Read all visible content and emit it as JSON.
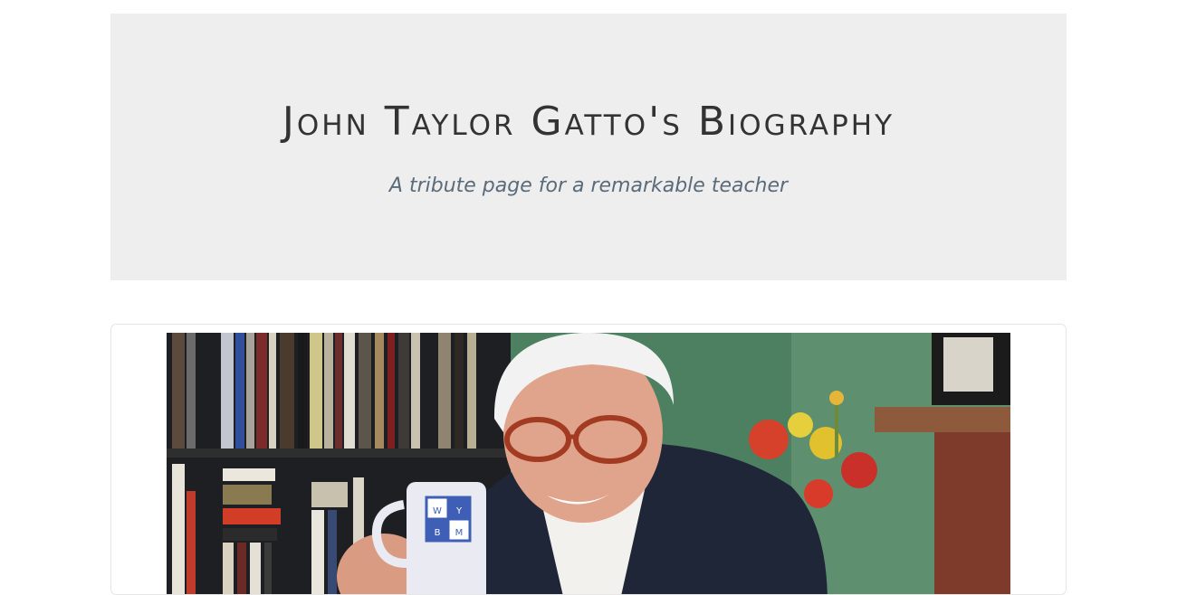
{
  "header": {
    "title": "John Taylor Gatto's Biography",
    "subtitle": "A tribute page for a remarkable teacher"
  },
  "image": {
    "mug_lettering": [
      "W",
      "Y",
      "B",
      "M"
    ]
  },
  "colors": {
    "jumbotron_bg": "#eeeeee",
    "title_text": "#333333",
    "subtitle_text": "#5b6b7a",
    "card_border": "#e6e6e6"
  }
}
